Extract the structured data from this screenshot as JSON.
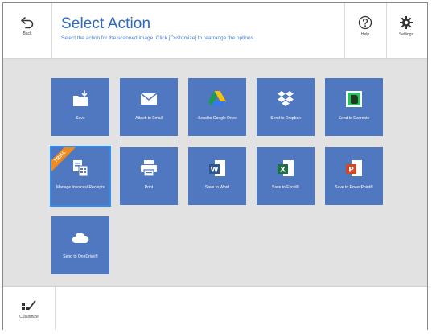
{
  "header": {
    "back_label": "Back",
    "title": "Select Action",
    "subtitle": "Select the action for the scanned image. Click [Customize] to rearrange the options.",
    "help_label": "Help",
    "settings_label": "Settings"
  },
  "actions": [
    {
      "label": "Save",
      "icon": "folder-save-icon"
    },
    {
      "label": "Attach to Email",
      "icon": "envelope-icon"
    },
    {
      "label": "Send to Google Drive",
      "icon": "google-drive-icon"
    },
    {
      "label": "Send to Dropbox",
      "icon": "dropbox-icon"
    },
    {
      "label": "Send to Evernote",
      "icon": "evernote-icon"
    },
    {
      "label": "Manage Invoices/ Receipts",
      "icon": "invoice-icon",
      "badge": "TRIAL",
      "selected": true
    },
    {
      "label": "Print",
      "icon": "printer-icon"
    },
    {
      "label": "Save to Word",
      "icon": "word-icon"
    },
    {
      "label": "Save to Excel®",
      "icon": "excel-icon"
    },
    {
      "label": "Save to PowerPoint®",
      "icon": "powerpoint-icon"
    },
    {
      "label": "Send to OneDrive®",
      "icon": "onedrive-icon"
    }
  ],
  "footer": {
    "customize_label": "Customize"
  },
  "colors": {
    "tile": "#4f78c1",
    "title": "#2b69c5",
    "content_bg": "#e2e2e2",
    "trial_badge": "#f08a1c",
    "selection": "#2d8ef0"
  }
}
